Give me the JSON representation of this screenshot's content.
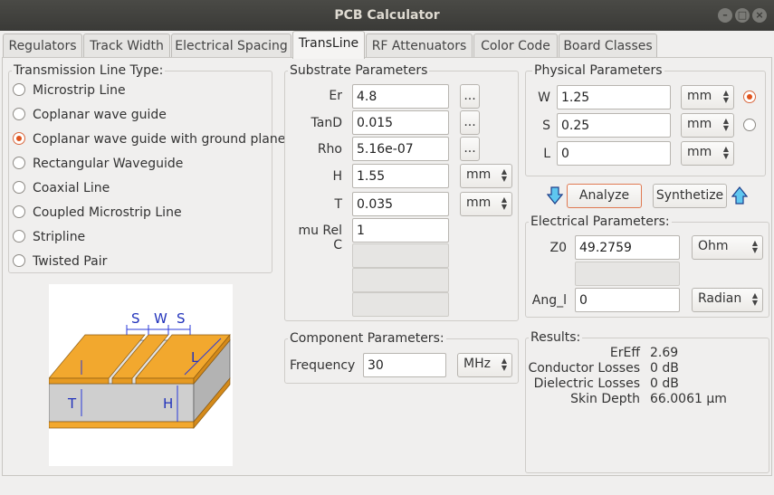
{
  "window": {
    "title": "PCB Calculator"
  },
  "tabs": [
    "Regulators",
    "Track Width",
    "Electrical Spacing",
    "TransLine",
    "RF Attenuators",
    "Color Code",
    "Board Classes"
  ],
  "line_types": {
    "title": "Transmission Line Type:",
    "items": [
      "Microstrip Line",
      "Coplanar wave guide",
      "Coplanar wave guide with ground plane",
      "Rectangular Waveguide",
      "Coaxial Line",
      "Coupled Microstrip Line",
      "Stripline",
      "Twisted Pair"
    ],
    "selected": "Coplanar wave guide with ground plane"
  },
  "diagram": {
    "labels": [
      "S",
      "W",
      "S",
      "L",
      "T",
      "H"
    ]
  },
  "substrate": {
    "title": "Substrate Parameters",
    "er_label": "Er",
    "er_value": "4.8",
    "tand_label": "TanD",
    "tand_value": "0.015",
    "rho_label": "Rho",
    "rho_value": "5.16e-07",
    "h_label": "H",
    "h_value": "1.55",
    "h_unit": "mm",
    "t_label": "T",
    "t_value": "0.035",
    "t_unit": "mm",
    "murel_label": "mu Rel C",
    "murel_value": "1",
    "more_button": "..."
  },
  "component": {
    "title": "Component Parameters:",
    "freq_label": "Frequency",
    "freq_value": "30",
    "freq_unit": "MHz"
  },
  "physical": {
    "title": "Physical Parameters",
    "w_label": "W",
    "w_value": "1.25",
    "w_unit": "mm",
    "s_label": "S",
    "s_value": "0.25",
    "s_unit": "mm",
    "l_label": "L",
    "l_value": "0",
    "l_unit": "mm"
  },
  "actions": {
    "analyze": "Analyze",
    "synthetize": "Synthetize"
  },
  "electrical": {
    "title": "Electrical Parameters:",
    "z0_label": "Z0",
    "z0_value": "49.2759",
    "z0_unit": "Ohm",
    "ang_label": "Ang_l",
    "ang_value": "0",
    "ang_unit": "Radian"
  },
  "results": {
    "title": "Results:",
    "rows": [
      {
        "label": "ErEff",
        "value": "2.69"
      },
      {
        "label": "Conductor Losses",
        "value": "0 dB"
      },
      {
        "label": "Dielectric Losses",
        "value": "0 dB"
      },
      {
        "label": "Skin Depth",
        "value": "66.0061 µm"
      }
    ]
  },
  "colors": {
    "accent": "#e0531c",
    "copper": "#f2a82e",
    "substrate": "#cfcfcf",
    "arrow": "#2a5ad9",
    "titlebar": "#3c3c39"
  }
}
